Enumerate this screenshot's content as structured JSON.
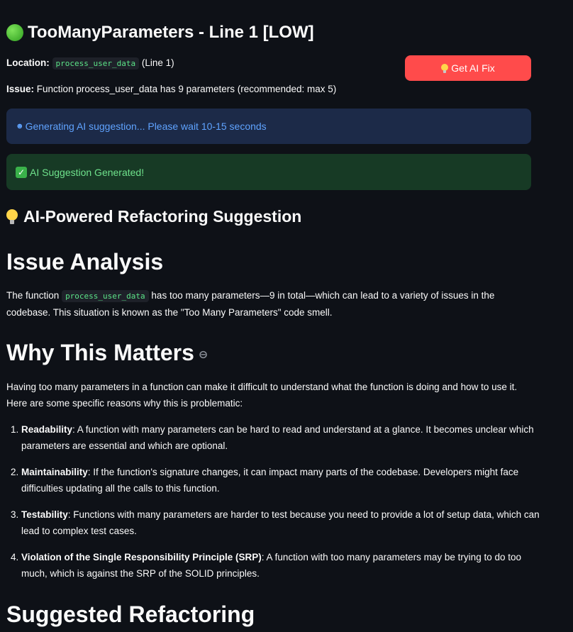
{
  "issue": {
    "title": "TooManyParameters - Line 1 [LOW]",
    "location_label": "Location:",
    "location_code": "process_user_data",
    "location_suffix": "(Line 1)",
    "issue_label": "Issue:",
    "issue_text": "Function process_user_data has 9 parameters (recommended: max 5)"
  },
  "fix_button": {
    "label": "Get AI Fix",
    "icon": "lightbulb-icon",
    "color": "#ff4b4b"
  },
  "alerts": {
    "info": "Generating AI suggestion... Please wait 10-15 seconds",
    "success": "AI Suggestion Generated!"
  },
  "suggestion": {
    "heading": "AI-Powered Refactoring Suggestion",
    "analysis_heading": "Issue Analysis",
    "analysis_prefix": "The function",
    "analysis_code": "process_user_data",
    "analysis_rest": "has too many parameters—9 in total—which can lead to a variety of issues in the codebase. This situation is known as the \"Too Many Parameters\" code smell.",
    "why_heading": "Why This Matters",
    "why_text": "Having too many parameters in a function can make it difficult to understand what the function is doing and how to use it. Here are some specific reasons why this is problematic:",
    "reasons": [
      {
        "term": "Readability",
        "text": ": A function with many parameters can be hard to read and understand at a glance. It becomes unclear which parameters are essential and which are optional."
      },
      {
        "term": "Maintainability",
        "text": ": If the function's signature changes, it can impact many parts of the codebase. Developers might face difficulties updating all the calls to this function."
      },
      {
        "term": "Testability",
        "text": ": Functions with many parameters are harder to test because you need to provide a lot of setup data, which can lead to complex test cases."
      },
      {
        "term": "Violation of the Single Responsibility Principle (SRP)",
        "text": ": A function with too many parameters may be trying to do too much, which is against the SRP of the SOLID principles."
      }
    ],
    "refactor_heading": "Suggested Refactoring"
  },
  "colors": {
    "background": "#0e1117",
    "code_green": "#5ce488",
    "info_bg": "#1c2a48",
    "success_bg": "#173a25"
  }
}
